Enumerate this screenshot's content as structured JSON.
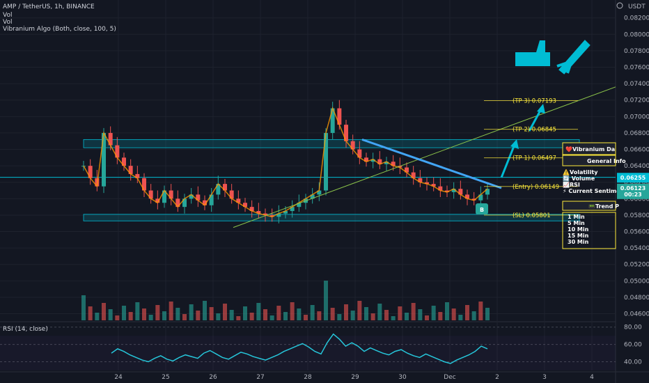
{
  "header": {
    "title": "AMP / TetherUS, 1h, BINANCE",
    "indicators": [
      "Vol",
      "Vol",
      "Vibranium Algo (Both, close, 100, 5)"
    ],
    "currency": "USDT"
  },
  "rsi_title": "RSI (14, close)",
  "price_tag": {
    "price": "0.06123",
    "countdown": "00:23",
    "high": "0.06255"
  },
  "signal_badge": "B",
  "levels": [
    {
      "label": "(TP 3) 0.07193",
      "price": 0.07193
    },
    {
      "label": "(TP 2) 0.06845",
      "price": 0.06845
    },
    {
      "label": "(TP 1) 0.06497",
      "price": 0.06497
    },
    {
      "label": "(Entry) 0.06149",
      "price": 0.06149
    },
    {
      "label": "(SL) 0.05801",
      "price": 0.05801
    }
  ],
  "dashboard": {
    "title": "❤️Vibranium Da",
    "general": "General Info",
    "items": [
      "⚠️Volatility",
      "🔄 Volume",
      "📈RSI",
      "⚡ Current Sentiment"
    ],
    "trend": "📟Trend P",
    "timeframes": [
      "1 Min",
      "5 Min",
      "10 Min",
      "15 Min",
      "30 Min"
    ]
  },
  "colors": {
    "up": "#26a69a",
    "down": "#ef5350",
    "accent": "#00bcd4",
    "level": "#ffeb3b",
    "rsi": "#26c6da"
  },
  "chart_data": [
    {
      "type": "candlestick",
      "title": "AMP / TetherUS, 1h, BINANCE",
      "x_ticks": [
        "24",
        "25",
        "26",
        "27",
        "28",
        "29",
        "30",
        "Dec",
        "2",
        "3",
        "4"
      ],
      "y_ticks": [
        "0.08200",
        "0.08000",
        "0.07800",
        "0.07600",
        "0.07400",
        "0.07200",
        "0.07000",
        "0.06800",
        "0.06600",
        "0.06400",
        "0.06200",
        "0.06000",
        "0.05800",
        "0.05600",
        "0.05400",
        "0.05200",
        "0.05000",
        "0.04800",
        "0.04600"
      ],
      "ylim": [
        0.0452,
        0.0835
      ],
      "close_series": [
        0.064,
        0.0625,
        0.0615,
        0.068,
        0.0665,
        0.065,
        0.064,
        0.063,
        0.0625,
        0.061,
        0.06,
        0.0595,
        0.061,
        0.06,
        0.059,
        0.06,
        0.0605,
        0.0598,
        0.0592,
        0.0605,
        0.0618,
        0.061,
        0.06,
        0.0595,
        0.059,
        0.0585,
        0.0582,
        0.058,
        0.0578,
        0.0582,
        0.0585,
        0.059,
        0.0595,
        0.06,
        0.0605,
        0.061,
        0.068,
        0.071,
        0.069,
        0.067,
        0.066,
        0.065,
        0.0645,
        0.0648,
        0.0642,
        0.0645,
        0.064,
        0.0638,
        0.0632,
        0.0625,
        0.062,
        0.0618,
        0.0615,
        0.061,
        0.0608,
        0.0612,
        0.0605,
        0.06,
        0.0598,
        0.0605,
        0.0612
      ]
    },
    {
      "type": "line",
      "title": "RSI (14, close)",
      "y_ticks": [
        "80.00",
        "60.00",
        "40.00"
      ],
      "ylim": [
        30,
        83
      ],
      "values": [
        50,
        55,
        52,
        48,
        45,
        42,
        40,
        44,
        47,
        43,
        41,
        45,
        48,
        46,
        44,
        50,
        53,
        49,
        45,
        43,
        47,
        51,
        49,
        46,
        44,
        42,
        45,
        48,
        52,
        55,
        58,
        61,
        57,
        52,
        49,
        62,
        72,
        66,
        58,
        62,
        58,
        52,
        56,
        53,
        50,
        48,
        52,
        54,
        50,
        47,
        45,
        49,
        46,
        43,
        40,
        38,
        42,
        45,
        48,
        52,
        58,
        55
      ]
    }
  ]
}
